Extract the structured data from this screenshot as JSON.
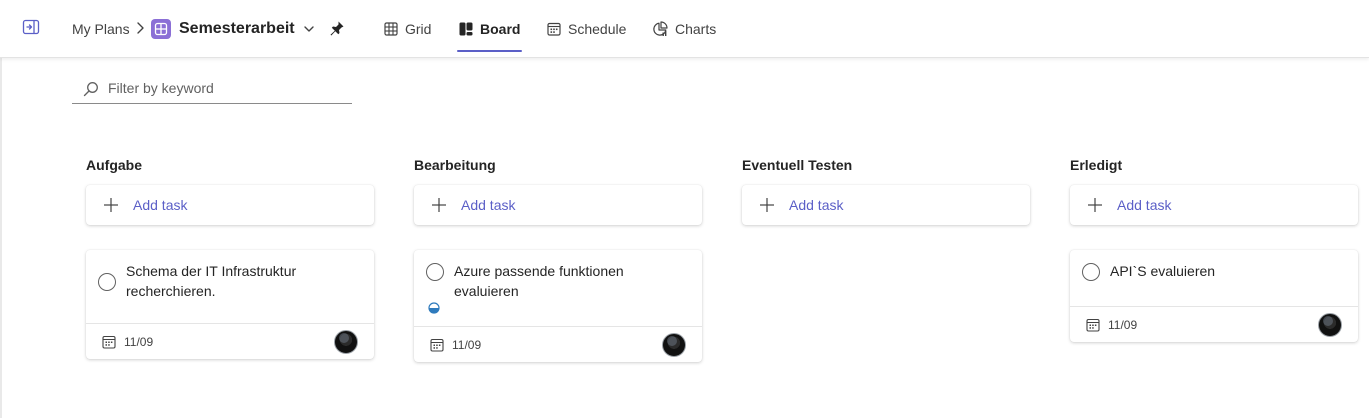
{
  "breadcrumb": {
    "root": "My Plans",
    "plan_name": "Semesterarbeit"
  },
  "tabs": [
    {
      "label": "Grid",
      "icon": "grid-icon",
      "active": false
    },
    {
      "label": "Board",
      "icon": "board-icon",
      "active": true
    },
    {
      "label": "Schedule",
      "icon": "schedule-icon",
      "active": false
    },
    {
      "label": "Charts",
      "icon": "charts-icon",
      "active": false
    }
  ],
  "filter": {
    "placeholder": "Filter by keyword",
    "value": ""
  },
  "colors": {
    "accent": "#5b5fc7",
    "plan_icon": "#8b6fd6",
    "progress": "#2f7bbd"
  },
  "columns": [
    {
      "title": "Aufgabe",
      "add_label": "Add task",
      "tasks": [
        {
          "title": "Schema der IT Infrastruktur recherchieren.",
          "due": "11/09",
          "progress": "not-started"
        }
      ]
    },
    {
      "title": "Bearbeitung",
      "add_label": "Add task",
      "tasks": [
        {
          "title": "Azure passende funktionen evaluieren",
          "due": "11/09",
          "progress": "in-progress"
        }
      ]
    },
    {
      "title": "Eventuell Testen",
      "add_label": "Add task",
      "tasks": []
    },
    {
      "title": "Erledigt",
      "add_label": "Add task",
      "tasks": [
        {
          "title": "API`S evaluieren",
          "due": "11/09",
          "progress": "not-started"
        }
      ]
    }
  ]
}
